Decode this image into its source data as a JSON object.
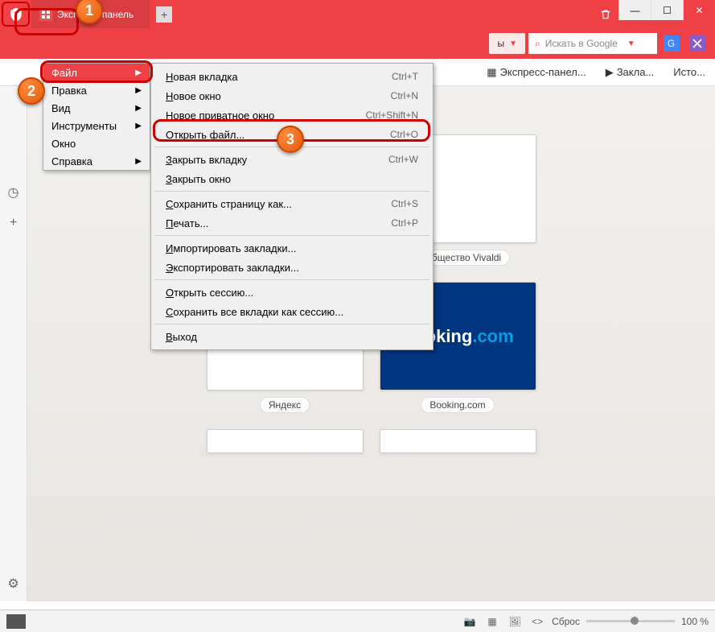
{
  "titlebar": {
    "tab_title": "Экспресс-панель"
  },
  "menu": {
    "items": [
      {
        "label": "Файл",
        "has_sub": true,
        "active": true
      },
      {
        "label": "Правка",
        "has_sub": true
      },
      {
        "label": "Вид",
        "has_sub": true
      },
      {
        "label": "Инструменты",
        "has_sub": true
      },
      {
        "label": "Окно",
        "has_sub": false
      },
      {
        "label": "Справка",
        "has_sub": true
      }
    ]
  },
  "file_menu": {
    "groups": [
      [
        {
          "label": "Новая вкладка",
          "shortcut": "Ctrl+T"
        },
        {
          "label": "Новое окно",
          "shortcut": "Ctrl+N"
        },
        {
          "label": "Новое приватное окно",
          "shortcut": "Ctrl+Shift+N"
        },
        {
          "label": "Открыть файл...",
          "shortcut": "Ctrl+O",
          "highlight": true
        }
      ],
      [
        {
          "label": "Закрыть вкладку",
          "shortcut": "Ctrl+W"
        },
        {
          "label": "Закрыть окно",
          "shortcut": ""
        }
      ],
      [
        {
          "label": "Сохранить страницу как...",
          "shortcut": "Ctrl+S"
        },
        {
          "label": "Печать...",
          "shortcut": "Ctrl+P"
        }
      ],
      [
        {
          "label": "Импортировать закладки...",
          "shortcut": ""
        },
        {
          "label": "Экспортировать закладки...",
          "shortcut": ""
        }
      ],
      [
        {
          "label": "Открыть сессию...",
          "shortcut": ""
        },
        {
          "label": "Сохранить все вкладки как сессию...",
          "shortcut": ""
        }
      ],
      [
        {
          "label": "Выход",
          "shortcut": ""
        }
      ]
    ]
  },
  "toolbar": {
    "addr_fragment": "ы",
    "search_placeholder": "Искать в Google"
  },
  "bookmarks": [
    "Экспресс-панел...",
    "Закла...",
    "Исто..."
  ],
  "tiles": {
    "row1": [
      {
        "label": "Сообщество Vivaldi"
      }
    ],
    "row2": [
      {
        "label": "Яндекс",
        "brand": "Яндекс"
      },
      {
        "label": "Booking.com",
        "brand": "Booking.com"
      }
    ]
  },
  "statusbar": {
    "reset": "Сброс",
    "zoom": "100 %"
  },
  "badges": {
    "b1": "1",
    "b2": "2",
    "b3": "3"
  }
}
